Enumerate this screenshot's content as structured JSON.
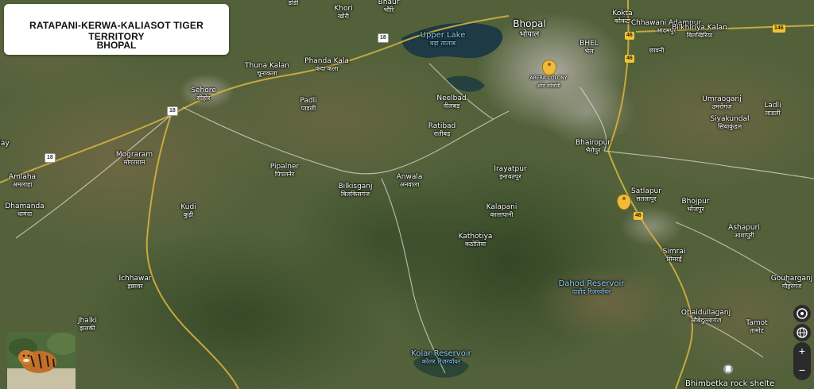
{
  "title": {
    "line1": "RATAPANI-KERWA-KALIASOT TIGER  TERRITORY",
    "line2": "BHOPAL"
  },
  "places": [
    {
      "en": "Bhaur",
      "hi": "भौरि"
    },
    {
      "en": "Khori",
      "hi": "खोरी"
    },
    {
      "en": "",
      "hi": "डोडी"
    },
    {
      "en": "Bhopal",
      "hi": "भोपाल"
    },
    {
      "en": "Upper Lake",
      "hi": "बड़ा तालाब"
    },
    {
      "en": "Kokta",
      "hi": "कोकटा"
    },
    {
      "en": "Chhawani Adampur",
      "hi": "आदमपुर"
    },
    {
      "en": "",
      "hi": "छावनी"
    },
    {
      "en": "Bilkhiriya Kalan",
      "hi": "बिलखिरिया"
    },
    {
      "en": "BHEL",
      "hi": "भेल"
    },
    {
      "en": "Thuna Kalan",
      "hi": "चूनाकला"
    },
    {
      "en": "Phanda Kala",
      "hi": "फंदा कला"
    },
    {
      "en": "Sehore",
      "hi": "सीहोर"
    },
    {
      "en": "ARERA COLONY",
      "hi": "अरेरा कॉलोनी"
    },
    {
      "en": "Padli",
      "hi": "पाडली"
    },
    {
      "en": "Neelbad",
      "hi": "नीलबड़"
    },
    {
      "en": "Ratibad",
      "hi": "रातीबड़"
    },
    {
      "en": "Umraoganj",
      "hi": "उमरोगंज"
    },
    {
      "en": "Siyakundal",
      "hi": "सियाकुंडल"
    },
    {
      "en": "Ladli",
      "hi": "लाडली"
    },
    {
      "en": "Bhairopur",
      "hi": "भैरोपुर"
    },
    {
      "en": "Mograram",
      "hi": "मोगराराम"
    },
    {
      "en": "Pipalner",
      "hi": "पिपलनेर"
    },
    {
      "en": "Irayatpur",
      "hi": "इनायतपुर"
    },
    {
      "en": "Amlaha",
      "hi": "अमलाहा"
    },
    {
      "en": "Anwala",
      "hi": "अनवाला"
    },
    {
      "en": "Bilkisganj",
      "hi": "बिलकिसगंज"
    },
    {
      "en": "Satlapur",
      "hi": "सतलापुर"
    },
    {
      "en": "Bhojpur",
      "hi": "भोजपुर"
    },
    {
      "en": "Dhamanda",
      "hi": "धामंदा"
    },
    {
      "en": "Kudi",
      "hi": "कुड़ी"
    },
    {
      "en": "Kalapani",
      "hi": "कालापानी"
    },
    {
      "en": "Ashapuri",
      "hi": "आशापुरी"
    },
    {
      "en": "Kathotiya",
      "hi": "कठोतिया"
    },
    {
      "en": "Simrai",
      "hi": "सिमरई"
    },
    {
      "en": "Gouharganj",
      "hi": "गौहरगंज"
    },
    {
      "en": "Ichhawar",
      "hi": "इछावर"
    },
    {
      "en": "Dahod Reservoir",
      "hi": "दाहोद रिज़रवॉयर"
    },
    {
      "en": "Obaidullaganj",
      "hi": "औबेदुल्लागंज"
    },
    {
      "en": "Jhalki",
      "hi": "झलकी"
    },
    {
      "en": "Tamot",
      "hi": "तामोट"
    },
    {
      "en": "Kolar Reservoir",
      "hi": "कोलर रिज़रवॉयर"
    },
    {
      "en": "Bhimbetka rock shelte",
      "hi": ""
    },
    {
      "en": "lay",
      "hi": ""
    }
  ],
  "roads": [
    "18",
    "18",
    "18",
    "46",
    "46",
    "46",
    "146"
  ],
  "controls": {
    "zoom_in": "+",
    "zoom_out": "−"
  }
}
